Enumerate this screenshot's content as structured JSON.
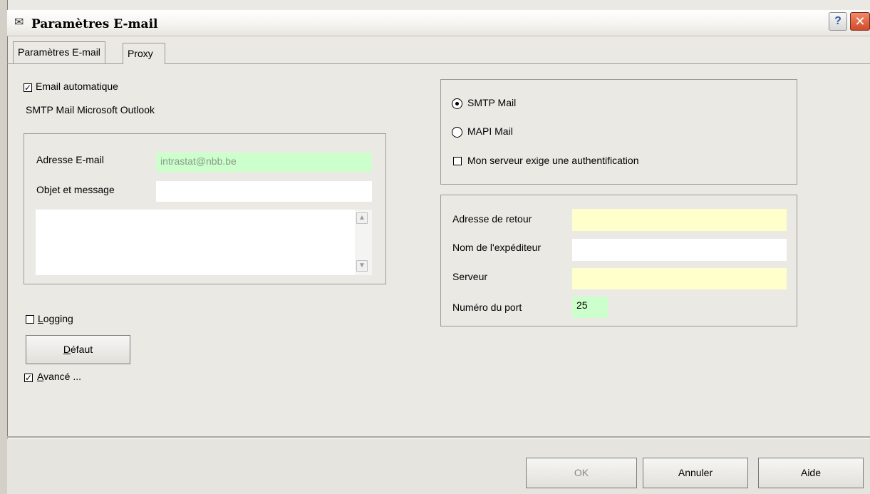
{
  "window": {
    "title": "Paramètres E-mail",
    "help_label": "?",
    "close_label": "✕"
  },
  "tabs": [
    {
      "label": "Paramètres E-mail",
      "active": true
    },
    {
      "label": "Proxy",
      "active": false
    }
  ],
  "left": {
    "auto_email": {
      "label": "Email automatique",
      "checked": true
    },
    "mail_type_text": "SMTP Mail Microsoft Outlook",
    "address_label": "Adresse E-mail",
    "address_value": "intrastat@nbb.be",
    "subject_label": "Objet et message",
    "subject_value": "",
    "message_value": "",
    "logging": {
      "label": "Logging",
      "checked": false
    },
    "default_button": "Défaut",
    "advanced": {
      "label": "Avancé ...",
      "checked": true
    }
  },
  "right": {
    "smtp": {
      "label": "SMTP Mail",
      "selected": true
    },
    "mapi": {
      "label": "MAPI Mail",
      "selected": false
    },
    "auth": {
      "label": "Mon serveur exige une authentification",
      "checked": false
    },
    "return_address_label": "Adresse de retour",
    "return_address_value": "",
    "sender_name_label": "Nom de l'expéditeur",
    "sender_name_value": "",
    "server_label": "Serveur",
    "server_value": "",
    "port_label": "Numéro du port",
    "port_value": "25"
  },
  "footer": {
    "ok": "OK",
    "cancel": "Annuler",
    "help": "Aide"
  },
  "colors": {
    "green_field": "#ccffcc",
    "yellow_field": "#ffffcc"
  }
}
